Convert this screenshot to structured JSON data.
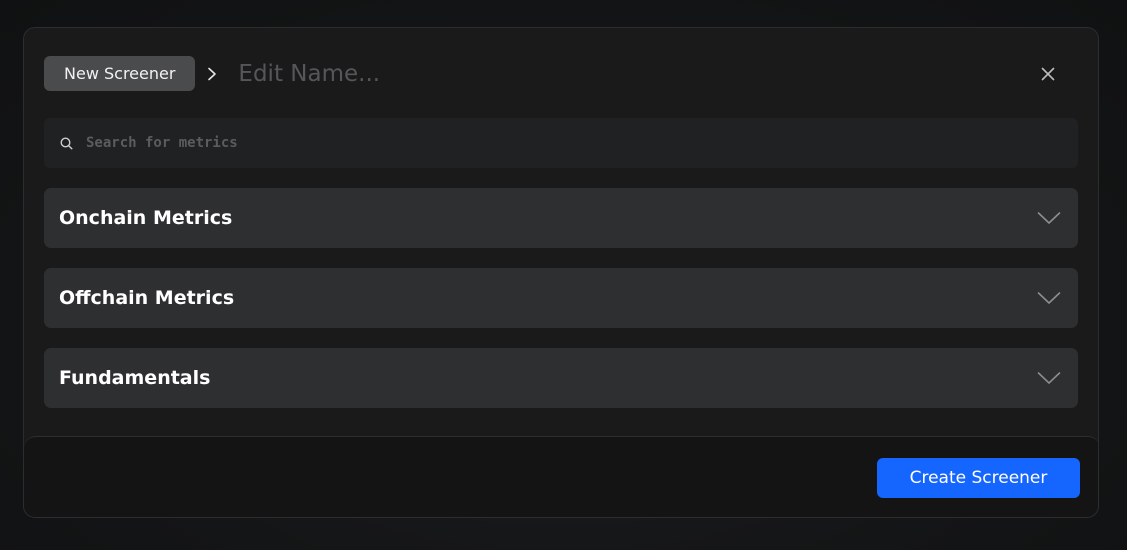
{
  "header": {
    "chip_label": "New Screener",
    "breadcrumb_separator_icon": "chevron-right-icon",
    "name_placeholder": "Edit Name...",
    "name_value": "",
    "close_icon": "close-icon"
  },
  "search": {
    "icon": "search-icon",
    "placeholder": "Search for metrics",
    "value": ""
  },
  "sections": [
    {
      "title": "Onchain Metrics",
      "icon": "chevron-down-icon"
    },
    {
      "title": "Offchain Metrics",
      "icon": "chevron-down-icon"
    },
    {
      "title": "Fundamentals",
      "icon": "chevron-down-icon"
    }
  ],
  "footer": {
    "create_label": "Create Screener"
  },
  "colors": {
    "accent": "#1565ff",
    "modal_bg": "#1a1a1b",
    "section_bg": "#2e2f31",
    "chip_bg": "#4a4b4d"
  }
}
